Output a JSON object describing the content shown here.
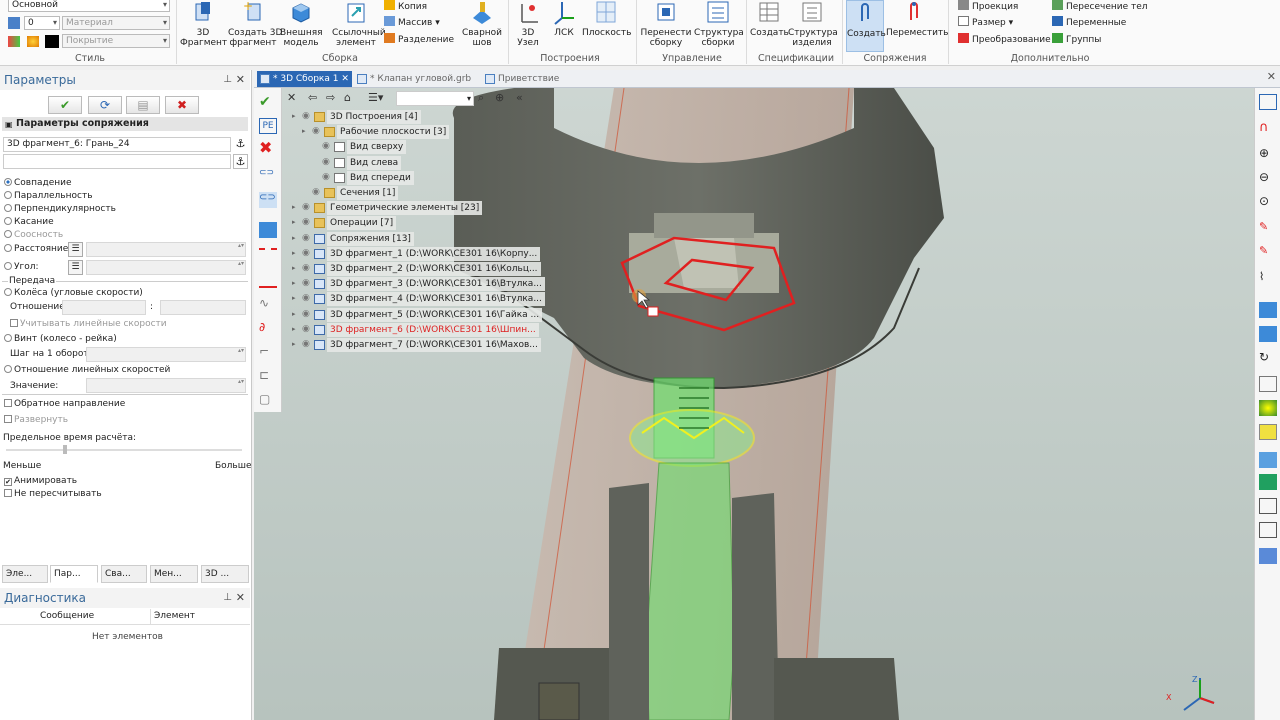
{
  "ribbon": {
    "style_combo1": "Основной",
    "style_combo2_num": "0",
    "style_combo2_placeholder": "Материал",
    "style_combo3_placeholder": "Покрытие",
    "groups": {
      "style": "Стиль",
      "assembly": "Сборка",
      "construct": "Построения",
      "manage": "Управление",
      "spec": "Спецификации",
      "mates": "Сопряжения",
      "extra": "Дополнительно"
    },
    "buttons": {
      "fragment3d": "3D\nФрагмент",
      "create3dfrag": "Создать 3D\nфрагмент",
      "ext_model": "Внешняя\nмодель",
      "ref_element": "Ссылочный\nэлемент",
      "copy": "Копия",
      "array": "Массив",
      "split": "Разделение",
      "weld": "Сварной\nшов",
      "node3d": "3D\nУзел",
      "lcs": "ЛСК",
      "plane": "Плоскость",
      "move_to_assembly": "Перенести\nсборку",
      "assembly_structure": "Структура\nсборки",
      "create_spec": "Создать",
      "product_structure": "Структура\nизделия",
      "create_mate": "Создать",
      "move_mate": "Переместить",
      "projection": "Проекция",
      "size": "Размер",
      "transform": "Преобразование",
      "body_intersection": "Пересечение тел",
      "variables": "Переменные",
      "groups_btn": "Группы"
    }
  },
  "params_panel": {
    "title": "Параметры",
    "section": "Параметры сопряжения",
    "selected": "3D фрагмент_6: Грань_24",
    "options": {
      "coincidence": "Совпадение",
      "parallel": "Параллельность",
      "perpendicular": "Перпендикулярность",
      "tangent": "Касание",
      "coaxial": "Соосность",
      "distance": "Расстояние:",
      "angle": "Угол:"
    },
    "transmission_group": "Передача",
    "wheels": "Колёса (угловые скорости)",
    "ratio": "Отношение:",
    "consider_linear": "Учитывать линейные скорости",
    "screw": "Винт (колесо - рейка)",
    "step": "Шаг на 1 оборот:",
    "linear_ratio": "Отношение линейных скоростей",
    "value": "Значение:",
    "reverse": "Обратное направление",
    "expand": "Развернуть",
    "time_limit": "Предельное время расчёта:",
    "less": "Меньше",
    "more": "Больше",
    "animate": "Анимировать",
    "no_recalc": "Не пересчитывать",
    "time_slider_fraction": 0.25
  },
  "bottom_tabs": [
    "Эле...",
    "Пар...",
    "Сва...",
    "Мен...",
    "3D ..."
  ],
  "diagnostics": {
    "title": "Диагностика",
    "col_message": "Сообщение",
    "col_element": "Элемент",
    "empty": "Нет элементов"
  },
  "doc_tabs": [
    "* 3D Сборка 1",
    "* Клапан угловой.grb",
    "Приветствие"
  ],
  "tree": [
    {
      "text": "3D Построения [4]",
      "level": 0,
      "icon": "folder"
    },
    {
      "text": "Рабочие плоскости [3]",
      "level": 1,
      "icon": "folder"
    },
    {
      "text": "Вид сверху",
      "level": 2,
      "icon": "plane"
    },
    {
      "text": "Вид слева",
      "level": 2,
      "icon": "plane"
    },
    {
      "text": "Вид спереди",
      "level": 2,
      "icon": "plane"
    },
    {
      "text": "Сечения [1]",
      "level": 1,
      "icon": "folder"
    },
    {
      "text": "Геометрические элементы [23]",
      "level": 0,
      "icon": "folder"
    },
    {
      "text": "Операции [7]",
      "level": 0,
      "icon": "folder"
    },
    {
      "text": "Сопряжения [13]",
      "level": 0,
      "icon": "mate"
    },
    {
      "text": "3D фрагмент_1 (D:\\WORK\\CE301 16\\Корпу...",
      "level": 0,
      "icon": "frag"
    },
    {
      "text": "3D фрагмент_2 (D:\\WORK\\CE301 16\\Кольц...",
      "level": 0,
      "icon": "frag"
    },
    {
      "text": "3D фрагмент_3 (D:\\WORK\\CE301 16\\Втулка...",
      "level": 0,
      "icon": "frag"
    },
    {
      "text": "3D фрагмент_4 (D:\\WORK\\CE301 16\\Втулка...",
      "level": 0,
      "icon": "frag"
    },
    {
      "text": "3D фрагмент_5 (D:\\WORK\\CE301 16\\Гайка ...",
      "level": 0,
      "icon": "frag"
    },
    {
      "text": "3D фрагмент_6 (D:\\WORK\\CE301 16\\Шпин...",
      "level": 0,
      "icon": "frag",
      "highlight": true
    },
    {
      "text": "3D фрагмент_7 (D:\\WORK\\CE301 16\\Махов...",
      "level": 0,
      "icon": "frag"
    }
  ],
  "axis_labels": {
    "z": "Z",
    "x": "X"
  },
  "colors": {
    "accent": "#2b67b4",
    "highlight_red": "#e02020",
    "selection_green": "#3fd03f",
    "selected_yellow": "#f0f020"
  }
}
